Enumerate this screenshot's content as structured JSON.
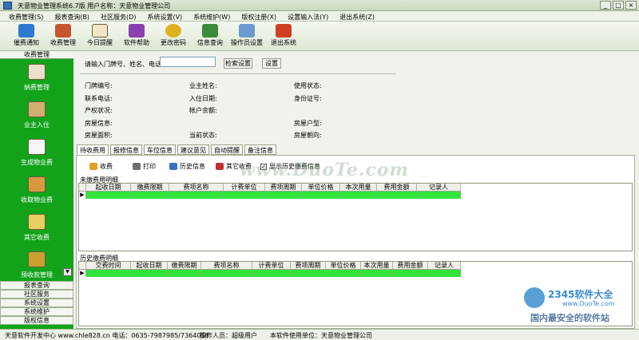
{
  "window": {
    "title": "天意物业管理系统6.7版    用户名称：天意物业管理公司",
    "minimize": "_",
    "maximize": "□",
    "close": "×"
  },
  "menu": [
    "收费管理(S)",
    "报表查询(B)",
    "社区服务(D)",
    "系统设置(V)",
    "系统维护(W)",
    "版权注册(X)",
    "设置输入法(Y)",
    "退出系统(Z)"
  ],
  "toolbar": [
    {
      "label": "催费通知",
      "icon": "notice-icon",
      "color": "#2d7bd0"
    },
    {
      "label": "收费管理",
      "icon": "cash-icon",
      "color": "#c8552f"
    },
    {
      "label": "今日提醒",
      "icon": "alarm-clock-icon",
      "color": "#f0e6c8"
    },
    {
      "label": "软件帮助",
      "icon": "help-book-icon",
      "color": "#8a3fb0"
    },
    {
      "label": "更改密码",
      "icon": "key-icon",
      "color": "#e0b020"
    },
    {
      "label": "信息查询",
      "icon": "books-icon",
      "color": "#3a8a3a"
    },
    {
      "label": "操作员设置",
      "icon": "operator-icon",
      "color": "#6a9ad0"
    },
    {
      "label": "退出系统",
      "icon": "exit-icon",
      "color": "#d04020"
    }
  ],
  "sidebar": {
    "header": "收费管理",
    "items": [
      {
        "label": "纳费管理",
        "icon": "payment-icon"
      },
      {
        "label": "业主入住",
        "icon": "move-in-icon"
      },
      {
        "label": "生成物业费",
        "icon": "generate-fee-icon"
      },
      {
        "label": "收取物业费",
        "icon": "collect-fee-icon"
      },
      {
        "label": "其它收费",
        "icon": "other-fee-icon"
      },
      {
        "label": "预收款管理",
        "icon": "prepay-icon"
      }
    ],
    "scroll_arrow": "▼",
    "bottom_items": [
      "报表查询",
      "社区服务",
      "系统设置",
      "系统维护",
      "版权信息"
    ]
  },
  "search": {
    "label": "请输入门牌号、姓名、电话:",
    "value": "",
    "button1": "检索设置",
    "button2": "设置"
  },
  "info": {
    "col1": [
      "门牌编号:",
      "联系电话:",
      "产权状况:",
      "房屋信息:",
      "房屋面积:"
    ],
    "col2": [
      "业主姓名:",
      "入住日期:",
      "帐户余额:",
      "当前状态:"
    ],
    "col3": [
      "使用状态:",
      "身份证号:",
      "房屋户型:",
      "房屋朝向:"
    ]
  },
  "tabs": [
    "待收费用",
    "报修信息",
    "车位信息",
    "建议意见",
    "自动提醒",
    "备注信息"
  ],
  "subtoolbar": [
    {
      "label": "收费",
      "icon": "coins-icon"
    },
    {
      "label": "打印",
      "icon": "printer-icon"
    },
    {
      "label": "历史信息",
      "icon": "history-icon"
    },
    {
      "label": "其它收费",
      "icon": "other-charge-icon"
    },
    {
      "label": "显示历史缴费信息",
      "icon": "checkbox-icon"
    }
  ],
  "grid1": {
    "title": "未缴费用明细",
    "headers": [
      "起收日期",
      "缴费限期",
      "费项名称",
      "计费单位",
      "费项周期",
      "单位价格",
      "本次用量",
      "费用金额",
      "记录人"
    ]
  },
  "grid2": {
    "title": "历史缴费明细",
    "headers": [
      "交费时间",
      "起收日期",
      "缴费限期",
      "费项名称",
      "计费单位",
      "费项周期",
      "单位价格",
      "本次用量",
      "费用金额",
      "记录人"
    ]
  },
  "row_indicator": "▶",
  "status": {
    "developer": "天意软件开发中心 www.chle828.cn 电话：0635-7987985/7364058",
    "operator": "操作人员：超级用户",
    "unit": "本软件使用单位：天意物业管理公司"
  },
  "watermark": {
    "center": "www.DuoTe.com",
    "brand": "2345软件大全",
    "url": "www.DuoTe.com",
    "slogan": "国内最安全的软件站"
  }
}
